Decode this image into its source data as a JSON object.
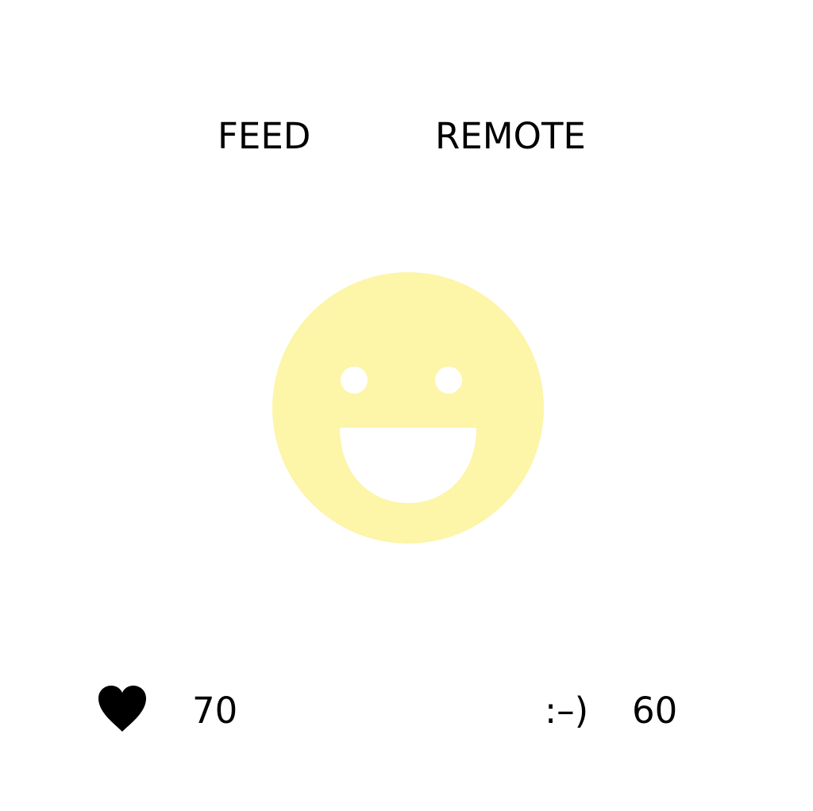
{
  "actions": {
    "feed_label": "FEED",
    "remote_label": "REMOTE"
  },
  "pet": {
    "face_color": "#fdf5a8",
    "expression": "happy"
  },
  "stats": {
    "health_icon": "heart-icon",
    "health_value": "70",
    "mood_label": ":–)",
    "mood_value": "60"
  }
}
